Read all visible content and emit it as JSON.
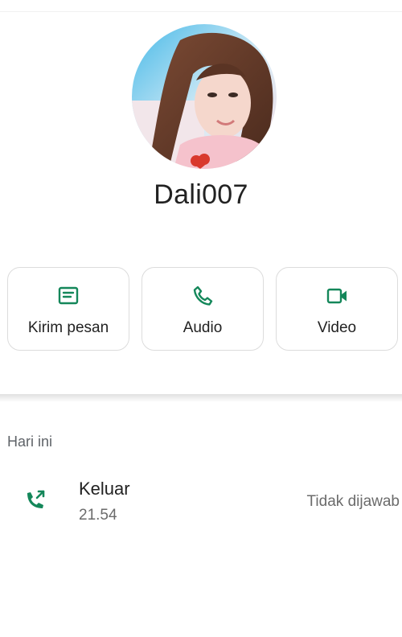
{
  "contact": {
    "name": "Dali007"
  },
  "actions": [
    {
      "label": "Kirim pesan",
      "icon": "message-icon"
    },
    {
      "label": "Audio",
      "icon": "phone-icon"
    },
    {
      "label": "Video",
      "icon": "video-camera-icon"
    }
  ],
  "history": {
    "section_title": "Hari ini",
    "calls": [
      {
        "type": "Keluar",
        "time": "21.54",
        "status": "Tidak dijawab",
        "icon": "outgoing-call-icon"
      }
    ]
  },
  "colors": {
    "accent": "#14875a",
    "card_border": "#dcdcdc",
    "secondary_text": "#6b6b6b"
  }
}
